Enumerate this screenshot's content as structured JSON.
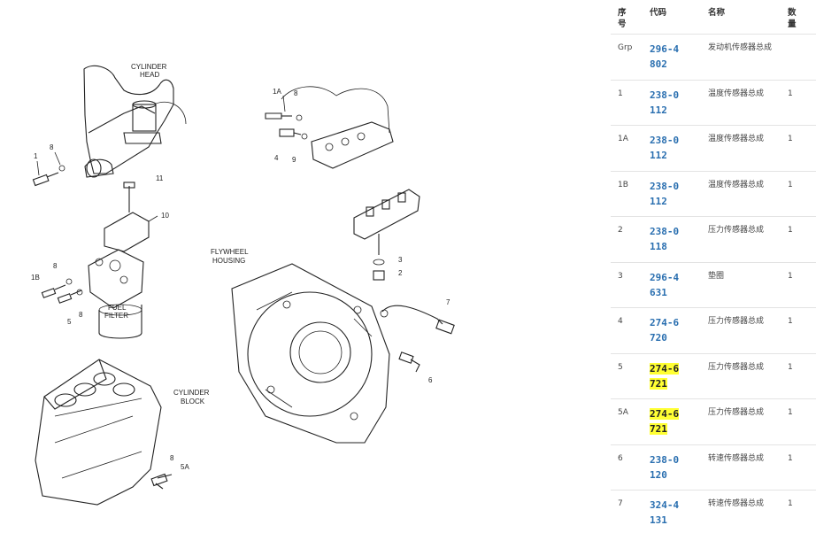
{
  "diagram": {
    "labels": {
      "cylinder_head": [
        "CYLINDER",
        "HEAD"
      ],
      "fuel_filter": [
        "FUEL",
        "FILTER"
      ],
      "flywheel_housing": [
        "FLYWHEEL",
        "HOUSING"
      ],
      "cylinder_block": [
        "CYLINDER",
        "BLOCK"
      ],
      "callouts": {
        "c1": "1",
        "c8a": "8",
        "c11": "11",
        "c10": "10",
        "c1b": "1B",
        "c8b": "8",
        "c8c": "8",
        "c5": "5",
        "c1a": "1A",
        "c8d": "8",
        "c4": "4",
        "c9": "9",
        "c3": "3",
        "c2": "2",
        "c7": "7",
        "c6": "6",
        "c8e": "8",
        "c5a": "5A"
      }
    }
  },
  "table": {
    "headers": {
      "seq": "序号",
      "code": "代码",
      "name": "名称",
      "qty": "数量"
    },
    "rows": [
      {
        "seq": "Grp",
        "code": "296-4802",
        "name": "发动机传感器总成",
        "qty": ""
      },
      {
        "seq": "1",
        "code": "238-0112",
        "name": "温度传感器总成",
        "qty": "1"
      },
      {
        "seq": "1A",
        "code": "238-0112",
        "name": "温度传感器总成",
        "qty": "1"
      },
      {
        "seq": "1B",
        "code": "238-0112",
        "name": "温度传感器总成",
        "qty": "1"
      },
      {
        "seq": "2",
        "code": "238-0118",
        "name": "压力传感器总成",
        "qty": "1"
      },
      {
        "seq": "3",
        "code": "296-4631",
        "name": "垫圈",
        "qty": "1"
      },
      {
        "seq": "4",
        "code": "274-6720",
        "name": "压力传感器总成",
        "qty": "1"
      },
      {
        "seq": "5",
        "code": "274-6721",
        "name": "压力传感器总成",
        "qty": "1",
        "highlight": true
      },
      {
        "seq": "5A",
        "code": "274-6721",
        "name": "压力传感器总成",
        "qty": "1",
        "highlight": true
      },
      {
        "seq": "6",
        "code": "238-0120",
        "name": "转速传感器总成",
        "qty": "1"
      },
      {
        "seq": "7",
        "code": "324-4131",
        "name": "转速传感器总成",
        "qty": "1"
      }
    ]
  },
  "colors": {
    "code": "#2a6fb0",
    "highlight": "#ffff33",
    "border": "#e3e3e3"
  }
}
